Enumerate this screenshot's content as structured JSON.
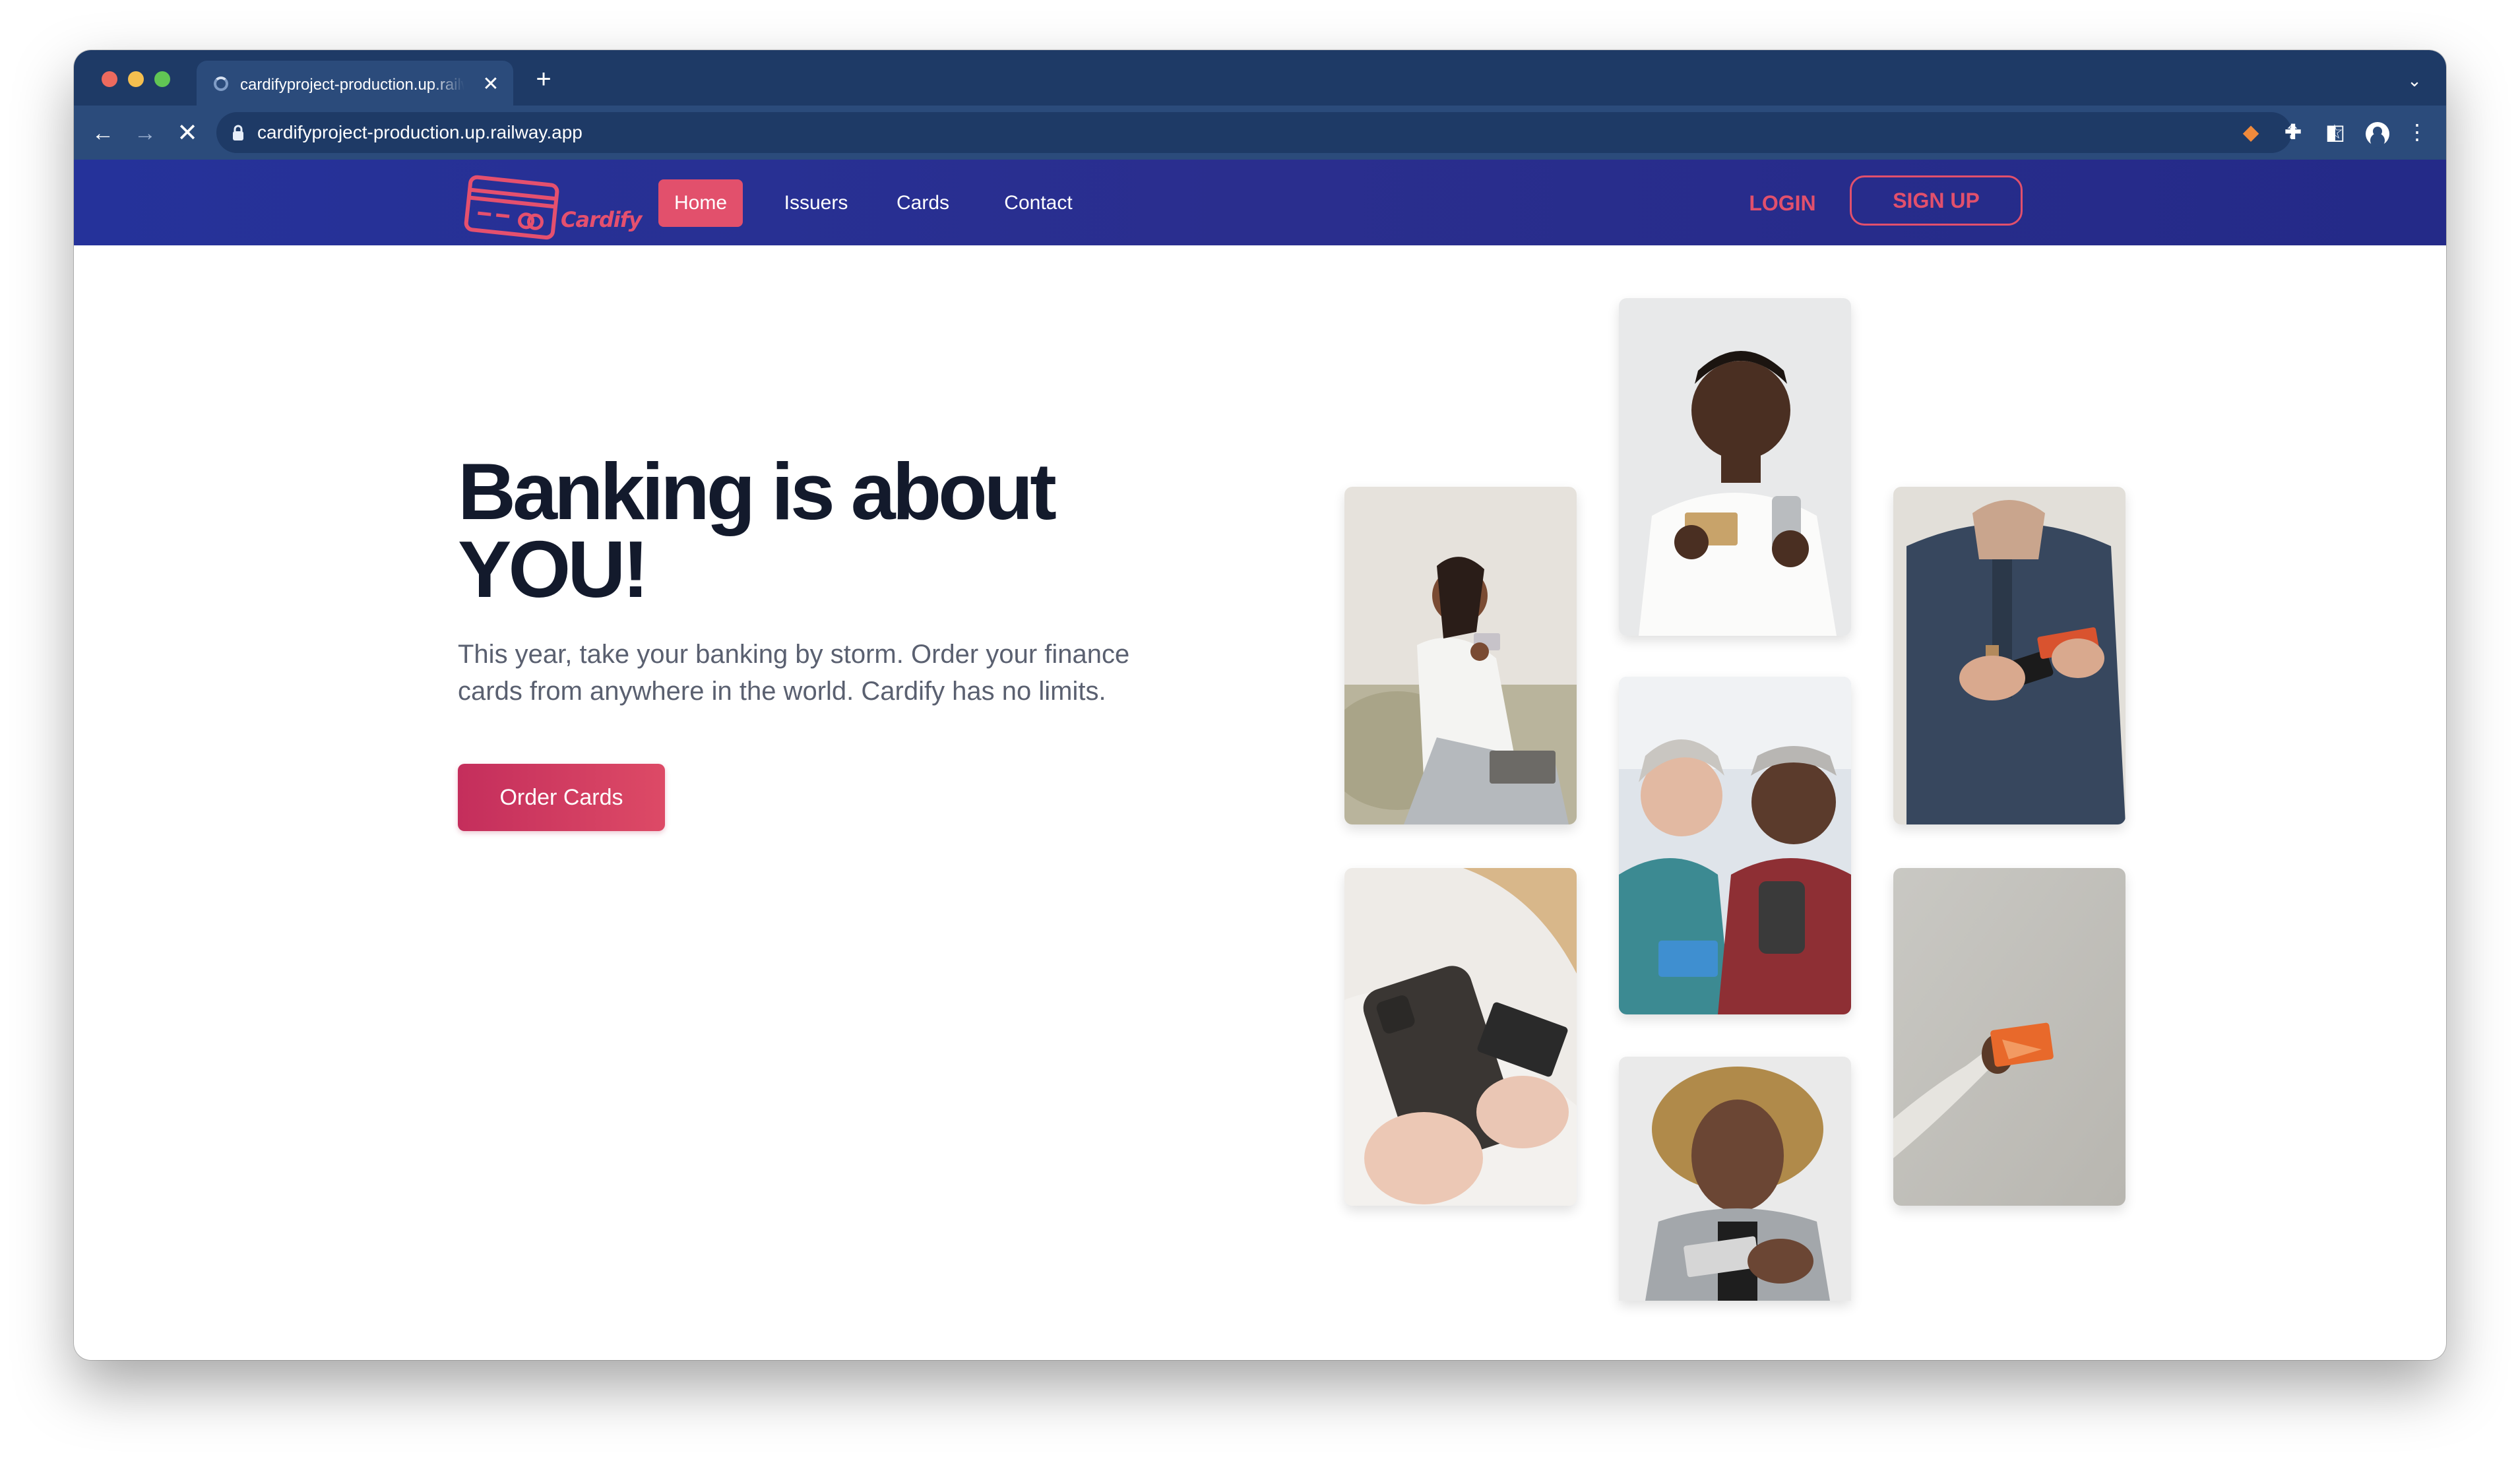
{
  "browser": {
    "tab_title": "cardifyproject-production.up.railway.app",
    "url": "cardifyproject-production.up.railway.app",
    "icons": [
      "back-icon",
      "forward-icon",
      "stop-loading-icon",
      "lock-icon",
      "share-icon",
      "star-icon",
      "metamask-fox-icon",
      "puzzle-icon",
      "side-panel-icon",
      "profile-icon",
      "more-icon",
      "tab-close-icon",
      "new-tab-icon",
      "tab-list-icon"
    ]
  },
  "nav": {
    "logo_text": "Cardify",
    "items": [
      "Home",
      "Issuers",
      "Cards",
      "Contact"
    ],
    "active": "Home",
    "login": "LOGIN",
    "signup": "SIGN UP",
    "accent": "#e2506c",
    "background": "#25329a"
  },
  "hero": {
    "headline": "Banking is about YOU!",
    "subtext": "This year, take your banking by storm. Order your finance cards from anywhere in the world. Cardify has no limits.",
    "cta": "Order Cards"
  },
  "gallery": {
    "photos": [
      "woman-on-couch-holding-card-photo",
      "hands-phone-and-card-photo",
      "man-smiling-phone-card-photo",
      "couple-with-phone-card-photo",
      "man-afro-holding-card-photo",
      "man-jacket-phone-card-photo",
      "hand-holding-orange-card-photo"
    ]
  }
}
